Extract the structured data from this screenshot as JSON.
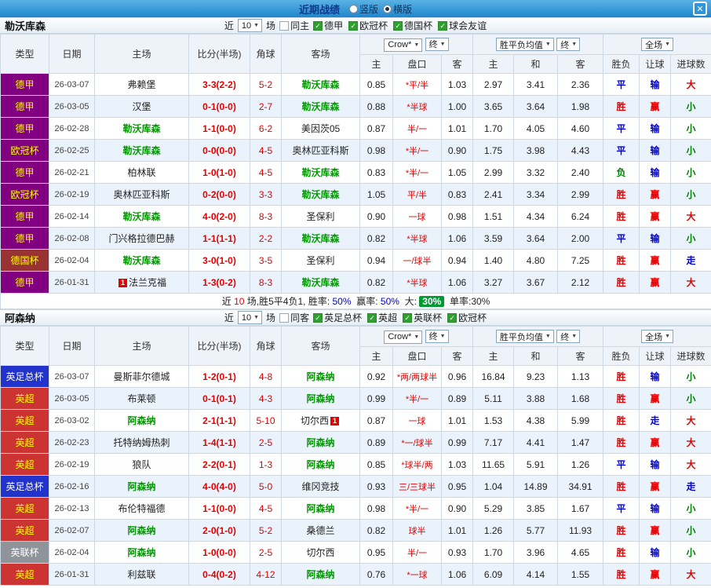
{
  "palette": {
    "c-red": "#e60000",
    "c-blue": "#0000cc",
    "c-green": "#008000",
    "c-teamgreen": "#009900",
    "c-title": "#0c3a8c",
    "topbar-light": "#5ab2e4",
    "topbar-dark": "#1f86cc",
    "badge-green": "#009933"
  },
  "titlebar": {
    "title": "近期战绩",
    "radios": [
      {
        "label": "竖版",
        "checked": false
      },
      {
        "label": "横版",
        "checked": true
      }
    ],
    "close": "✕"
  },
  "table_header": {
    "near": "近",
    "games": "场",
    "type": "类型",
    "date": "日期",
    "home": "主场",
    "score": "比分(半场)",
    "corner": "角球",
    "away": "客场",
    "odds_dd": "Crow*",
    "odds_state_dd": "终",
    "europe_dd": "胜平负均值",
    "europe_state_dd": "终",
    "scope_dd": "全场",
    "h_home": "主",
    "h_handicap": "盘口",
    "h_away": "客",
    "e_home": "主",
    "e_draw": "和",
    "e_away": "客",
    "r_wdl": "胜负",
    "r_handicap": "让球",
    "r_goals": "进球数"
  },
  "sections": [
    {
      "team": "勒沃库森",
      "filter": {
        "count": "10",
        "same_label": "同主",
        "leagues": [
          "德甲",
          "欧冠杯",
          "德国杯",
          "球会友谊"
        ]
      },
      "rows": [
        {
          "type": "德甲",
          "type_bg": "#800080",
          "type_fg": "#ffff00",
          "date": "26-03-07",
          "home": "弗赖堡",
          "score": "3-3(2-2)",
          "corner": "5-2",
          "away": "勒沃库森",
          "away_cls": "tg",
          "a1": "0.85",
          "hcap": "*平/半",
          "a2": "1.03",
          "e1": "2.97",
          "e2": "3.41",
          "e3": "2.36",
          "wdl": "平",
          "wdl_c": "#0000cc",
          "let": "输",
          "let_c": "#0000cc",
          "goal": "大",
          "goal_c": "#e60000"
        },
        {
          "type": "德甲",
          "type_bg": "#800080",
          "type_fg": "#ffff00",
          "date": "26-03-05",
          "home": "汉堡",
          "score": "0-1(0-0)",
          "corner": "2-7",
          "away": "勒沃库森",
          "away_cls": "tg",
          "a1": "0.88",
          "hcap": "*半球",
          "a2": "1.00",
          "e1": "3.65",
          "e2": "3.64",
          "e3": "1.98",
          "wdl": "胜",
          "wdl_c": "#e60000",
          "let": "赢",
          "let_c": "#e60000",
          "goal": "小",
          "goal_c": "#008000"
        },
        {
          "type": "德甲",
          "type_bg": "#800080",
          "type_fg": "#ffff00",
          "date": "26-02-28",
          "home": "勒沃库森",
          "home_cls": "tg",
          "score": "1-1(0-0)",
          "corner": "6-2",
          "away": "美因茨05",
          "a1": "0.87",
          "hcap": "半/一",
          "a2": "1.01",
          "e1": "1.70",
          "e2": "4.05",
          "e3": "4.60",
          "wdl": "平",
          "wdl_c": "#0000cc",
          "let": "输",
          "let_c": "#0000cc",
          "goal": "小",
          "goal_c": "#008000"
        },
        {
          "type": "欧冠杯",
          "type_bg": "#800080",
          "type_fg": "#ffff00",
          "date": "26-02-25",
          "home": "勒沃库森",
          "home_cls": "tg",
          "score": "0-0(0-0)",
          "corner": "4-5",
          "away": "奥林匹亚科斯",
          "a1": "0.98",
          "hcap": "*半/一",
          "a2": "0.90",
          "e1": "1.75",
          "e2": "3.98",
          "e3": "4.43",
          "wdl": "平",
          "wdl_c": "#0000cc",
          "let": "输",
          "let_c": "#0000cc",
          "goal": "小",
          "goal_c": "#008000"
        },
        {
          "type": "德甲",
          "type_bg": "#800080",
          "type_fg": "#ffff00",
          "date": "26-02-21",
          "home": "柏林联",
          "score": "1-0(1-0)",
          "corner": "4-5",
          "away": "勒沃库森",
          "away_cls": "tg",
          "a1": "0.83",
          "hcap": "*半/一",
          "a2": "1.05",
          "e1": "2.99",
          "e2": "3.32",
          "e3": "2.40",
          "wdl": "负",
          "wdl_c": "#008000",
          "let": "输",
          "let_c": "#0000cc",
          "goal": "小",
          "goal_c": "#008000"
        },
        {
          "type": "欧冠杯",
          "type_bg": "#800080",
          "type_fg": "#ffff00",
          "date": "26-02-19",
          "home": "奥林匹亚科斯",
          "score": "0-2(0-0)",
          "corner": "3-3",
          "away": "勒沃库森",
          "away_cls": "tg",
          "a1": "1.05",
          "hcap": "平/半",
          "a2": "0.83",
          "e1": "2.41",
          "e2": "3.34",
          "e3": "2.99",
          "wdl": "胜",
          "wdl_c": "#e60000",
          "let": "赢",
          "let_c": "#e60000",
          "goal": "小",
          "goal_c": "#008000"
        },
        {
          "type": "德甲",
          "type_bg": "#800080",
          "type_fg": "#ffff00",
          "date": "26-02-14",
          "home": "勒沃库森",
          "home_cls": "tg",
          "score": "4-0(2-0)",
          "corner": "8-3",
          "away": "圣保利",
          "a1": "0.90",
          "hcap": "一球",
          "a2": "0.98",
          "e1": "1.51",
          "e2": "4.34",
          "e3": "6.24",
          "wdl": "胜",
          "wdl_c": "#e60000",
          "let": "赢",
          "let_c": "#e60000",
          "goal": "大",
          "goal_c": "#e60000"
        },
        {
          "type": "德甲",
          "type_bg": "#800080",
          "type_fg": "#ffff00",
          "date": "26-02-08",
          "home": "门兴格拉德巴赫",
          "score": "1-1(1-1)",
          "corner": "2-2",
          "away": "勒沃库森",
          "away_cls": "tg",
          "a1": "0.82",
          "hcap": "*半球",
          "a2": "1.06",
          "e1": "3.59",
          "e2": "3.64",
          "e3": "2.00",
          "wdl": "平",
          "wdl_c": "#0000cc",
          "let": "输",
          "let_c": "#0000cc",
          "goal": "小",
          "goal_c": "#008000"
        },
        {
          "type": "德国杯",
          "type_bg": "#993333",
          "type_fg": "#ffff00",
          "date": "26-02-04",
          "home": "勒沃库森",
          "home_cls": "tg",
          "score": "3-0(1-0)",
          "corner": "3-5",
          "away": "圣保利",
          "a1": "0.94",
          "hcap": "一/球半",
          "a2": "0.94",
          "e1": "1.40",
          "e2": "4.80",
          "e3": "7.25",
          "wdl": "胜",
          "wdl_c": "#e60000",
          "let": "赢",
          "let_c": "#e60000",
          "goal": "走",
          "goal_c": "#0000cc"
        },
        {
          "type": "德甲",
          "type_bg": "#800080",
          "type_fg": "#ffff00",
          "date": "26-01-31",
          "home": "法兰克福",
          "home_badge": "1",
          "score": "1-3(0-2)",
          "corner": "8-3",
          "away": "勒沃库森",
          "away_cls": "tg",
          "a1": "0.82",
          "hcap": "*半球",
          "a2": "1.06",
          "e1": "3.27",
          "e2": "3.67",
          "e3": "2.12",
          "wdl": "胜",
          "wdl_c": "#e60000",
          "let": "赢",
          "let_c": "#e60000",
          "goal": "大",
          "goal_c": "#e60000"
        }
      ],
      "summary": [
        {
          "t": "近"
        },
        {
          "t": "10",
          "c": "#e60000"
        },
        {
          "t": "场,胜5平4负1, 胜率:"
        },
        {
          "t": "50%",
          "c": "#0000cc"
        },
        {
          "t": " 赢率:"
        },
        {
          "t": "50%",
          "c": "#0000cc"
        },
        {
          "t": " 大:"
        },
        {
          "t": "30%",
          "c": "#ffffff",
          "bg": "#009933",
          "cls": "badge"
        },
        {
          "t": " 单率:30%"
        }
      ]
    },
    {
      "team": "阿森纳",
      "filter": {
        "count": "10",
        "same_label": "同客",
        "leagues": [
          "英足总杯",
          "英超",
          "英联杯",
          "欧冠杯"
        ]
      },
      "rows": [
        {
          "type": "英足总杯",
          "type_bg": "#2233cc",
          "type_fg": "#ffffff",
          "date": "26-03-07",
          "home": "曼斯菲尔德城",
          "score": "1-2(0-1)",
          "corner": "4-8",
          "away": "阿森纳",
          "away_cls": "tg",
          "a1": "0.92",
          "hcap": "*两/两球半",
          "a2": "0.96",
          "e1": "16.84",
          "e2": "9.23",
          "e3": "1.13",
          "wdl": "胜",
          "wdl_c": "#e60000",
          "let": "输",
          "let_c": "#0000cc",
          "goal": "小",
          "goal_c": "#008000"
        },
        {
          "type": "英超",
          "type_bg": "#cc3333",
          "type_fg": "#ffff00",
          "date": "26-03-05",
          "home": "布莱顿",
          "score": "0-1(0-1)",
          "corner": "4-3",
          "away": "阿森纳",
          "away_cls": "tg",
          "a1": "0.99",
          "hcap": "*半/一",
          "a2": "0.89",
          "e1": "5.11",
          "e2": "3.88",
          "e3": "1.68",
          "wdl": "胜",
          "wdl_c": "#e60000",
          "let": "赢",
          "let_c": "#e60000",
          "goal": "小",
          "goal_c": "#008000"
        },
        {
          "type": "英超",
          "type_bg": "#cc3333",
          "type_fg": "#ffff00",
          "date": "26-03-02",
          "home": "阿森纳",
          "home_cls": "tg",
          "score": "2-1(1-1)",
          "corner": "5-10",
          "away": "切尔西",
          "away_badge": "1",
          "a1": "0.87",
          "hcap": "一球",
          "a2": "1.01",
          "e1": "1.53",
          "e2": "4.38",
          "e3": "5.99",
          "wdl": "胜",
          "wdl_c": "#e60000",
          "let": "走",
          "let_c": "#0000cc",
          "goal": "大",
          "goal_c": "#e60000"
        },
        {
          "type": "英超",
          "type_bg": "#cc3333",
          "type_fg": "#ffff00",
          "date": "26-02-23",
          "home": "托特纳姆热刺",
          "score": "1-4(1-1)",
          "corner": "2-5",
          "away": "阿森纳",
          "away_cls": "tg",
          "a1": "0.89",
          "hcap": "*一/球半",
          "a2": "0.99",
          "e1": "7.17",
          "e2": "4.41",
          "e3": "1.47",
          "wdl": "胜",
          "wdl_c": "#e60000",
          "let": "赢",
          "let_c": "#e60000",
          "goal": "大",
          "goal_c": "#e60000"
        },
        {
          "type": "英超",
          "type_bg": "#cc3333",
          "type_fg": "#ffff00",
          "date": "26-02-19",
          "home": "狼队",
          "score": "2-2(0-1)",
          "corner": "1-3",
          "away": "阿森纳",
          "away_cls": "tg",
          "a1": "0.85",
          "hcap": "*球半/两",
          "a2": "1.03",
          "e1": "11.65",
          "e2": "5.91",
          "e3": "1.26",
          "wdl": "平",
          "wdl_c": "#0000cc",
          "let": "输",
          "let_c": "#0000cc",
          "goal": "大",
          "goal_c": "#e60000"
        },
        {
          "type": "英足总杯",
          "type_bg": "#2233cc",
          "type_fg": "#ffffff",
          "date": "26-02-16",
          "home": "阿森纳",
          "home_cls": "tg",
          "score": "4-0(4-0)",
          "corner": "5-0",
          "away": "维冈竞技",
          "a1": "0.93",
          "hcap": "三/三球半",
          "a2": "0.95",
          "e1": "1.04",
          "e2": "14.89",
          "e3": "34.91",
          "wdl": "胜",
          "wdl_c": "#e60000",
          "let": "赢",
          "let_c": "#e60000",
          "goal": "走",
          "goal_c": "#0000cc"
        },
        {
          "type": "英超",
          "type_bg": "#cc3333",
          "type_fg": "#ffff00",
          "date": "26-02-13",
          "home": "布伦特福德",
          "score": "1-1(0-0)",
          "corner": "4-5",
          "away": "阿森纳",
          "away_cls": "tg",
          "a1": "0.98",
          "hcap": "*半/一",
          "a2": "0.90",
          "e1": "5.29",
          "e2": "3.85",
          "e3": "1.67",
          "wdl": "平",
          "wdl_c": "#0000cc",
          "let": "输",
          "let_c": "#0000cc",
          "goal": "小",
          "goal_c": "#008000"
        },
        {
          "type": "英超",
          "type_bg": "#cc3333",
          "type_fg": "#ffff00",
          "date": "26-02-07",
          "home": "阿森纳",
          "home_cls": "tg",
          "score": "2-0(1-0)",
          "corner": "5-2",
          "away": "桑德兰",
          "a1": "0.82",
          "hcap": "球半",
          "a2": "1.01",
          "e1": "1.26",
          "e2": "5.77",
          "e3": "11.93",
          "wdl": "胜",
          "wdl_c": "#e60000",
          "let": "赢",
          "let_c": "#e60000",
          "goal": "小",
          "goal_c": "#008000"
        },
        {
          "type": "英联杯",
          "type_bg": "#8f949b",
          "type_fg": "#ffffff",
          "date": "26-02-04",
          "home": "阿森纳",
          "home_cls": "tg",
          "score": "1-0(0-0)",
          "corner": "2-5",
          "away": "切尔西",
          "a1": "0.95",
          "hcap": "半/一",
          "a2": "0.93",
          "e1": "1.70",
          "e2": "3.96",
          "e3": "4.65",
          "wdl": "胜",
          "wdl_c": "#e60000",
          "let": "输",
          "let_c": "#0000cc",
          "goal": "小",
          "goal_c": "#008000"
        },
        {
          "type": "英超",
          "type_bg": "#cc3333",
          "type_fg": "#ffff00",
          "date": "26-01-31",
          "home": "利兹联",
          "score": "0-4(0-2)",
          "corner": "4-12",
          "away": "阿森纳",
          "away_cls": "tg",
          "a1": "0.76",
          "hcap": "*一球",
          "a2": "1.06",
          "e1": "6.09",
          "e2": "4.14",
          "e3": "1.55",
          "wdl": "胜",
          "wdl_c": "#e60000",
          "let": "赢",
          "let_c": "#e60000",
          "goal": "大",
          "goal_c": "#e60000"
        }
      ]
    }
  ]
}
